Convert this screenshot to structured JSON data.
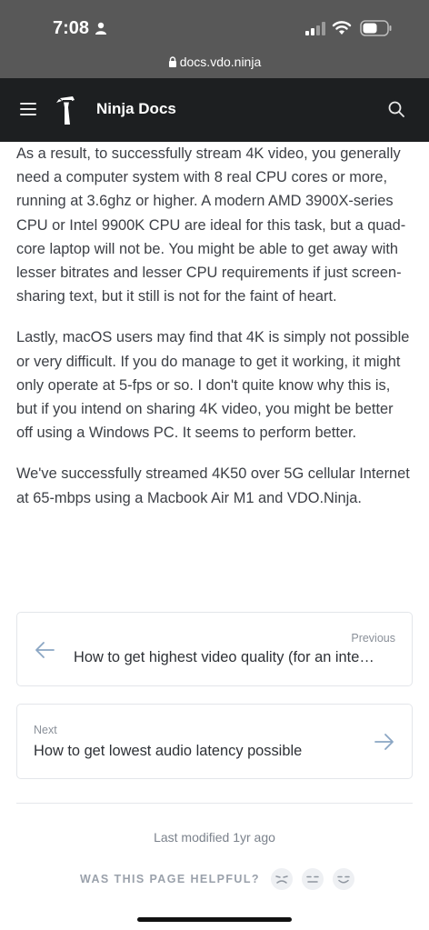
{
  "status_bar": {
    "time": "7:08"
  },
  "browser": {
    "url": "docs.vdo.ninja"
  },
  "navbar": {
    "title": "Ninja Docs"
  },
  "content": {
    "paragraphs": [
      "As a result, to successfully stream 4K video, you generally need a computer system with 8 real CPU cores or more, running at 3.6ghz or higher. A modern AMD 3900X-series CPU or Intel 9900K CPU are ideal for this task, but a quad-core laptop will not be. You might be able to get away with lesser bitrates and lesser CPU requirements if just screen-sharing text, but it still is not for the faint of heart.",
      "Lastly, macOS users may find that 4K is simply not possible or very difficult. If you do manage to get it working, it might only operate at 5-fps or so. I don't quite know why this is, but if you intend on sharing 4K video, you might be better off using a Windows PC. It seems to perform better.",
      "We've successfully streamed 4K50 over 5G cellular Internet at 65-mbps using a Macbook Air M1 and VDO.Ninja."
    ]
  },
  "pagination": {
    "previous": {
      "kicker": "Previous",
      "title": "How to get highest video quality (for an inte…"
    },
    "next": {
      "kicker": "Next",
      "title": "How to get lowest audio latency possible"
    }
  },
  "footer": {
    "last_modified": "Last modified 1yr ago",
    "helpful_label": "WAS THIS PAGE HELPFUL?"
  },
  "colors": {
    "status_bar": "#585858",
    "navbar": "#1d1f21",
    "text": "#3d4046",
    "muted": "#8a9099"
  }
}
